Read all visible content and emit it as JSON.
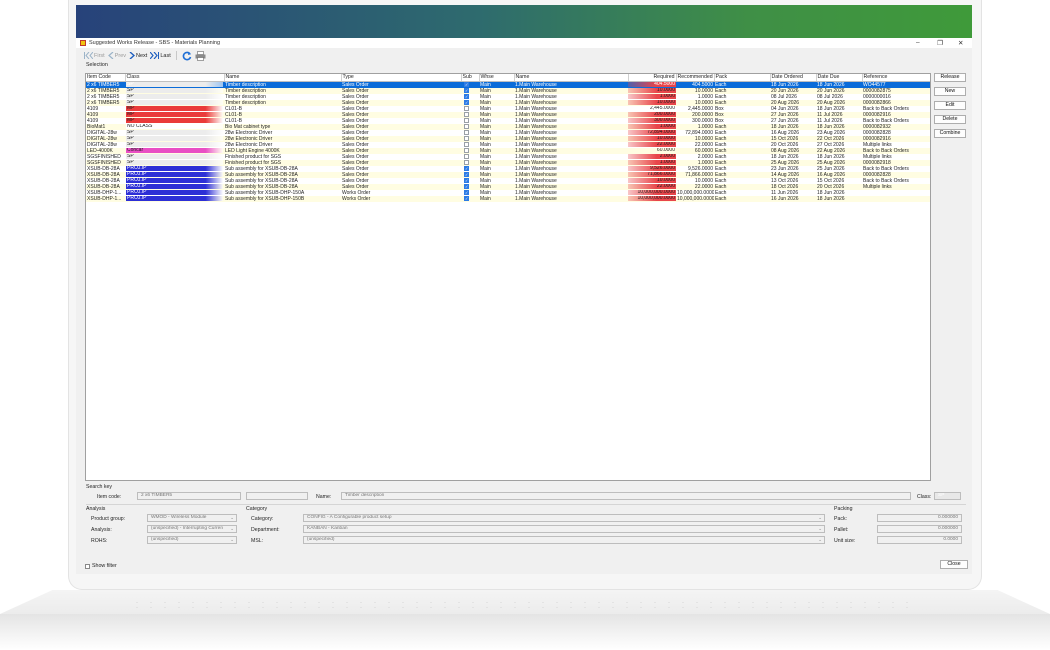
{
  "window": {
    "title": "Suggested Works Release - SBS - Materials Planning",
    "minimize": "–",
    "maximize": "❐",
    "close": "✕"
  },
  "toolbar": {
    "first": "First",
    "prev": "Prev",
    "next": "Next",
    "last": "Last"
  },
  "selection_label": "Selection",
  "columns": [
    "Item Code",
    "Class",
    "Name",
    "Type",
    "Sub",
    "Whse",
    "Name",
    "Required",
    "Recommended",
    "Pack",
    "Date Ordered",
    "Date Due",
    "Reference"
  ],
  "class_colors": {
    "SP": "#ececec",
    "MP": "#ea3a3a",
    "NO CLASS": "#ffffff",
    "Concar": "#e94fc4",
    "PROJ.IP": "#2d2fd6"
  },
  "rows": [
    {
      "code": "2 x6 TIMBER5",
      "cls": "SP",
      "name": "Timber description",
      "type": "Sales Order",
      "sub": true,
      "whse": "Main",
      "wname": "1.Main Warehouse",
      "req": "404.5000",
      "req_red": true,
      "rec": "404.5000",
      "pack": "Each",
      "ordered": "18 Jun 2026",
      "due": "18 Jun 2026",
      "ref": "WO44577",
      "selected": true
    },
    {
      "code": "2 x6 TIMBER5",
      "cls": "SP",
      "name": "Timber description",
      "type": "Sales Order",
      "sub": true,
      "whse": "Main",
      "wname": "1.Main Warehouse",
      "req": "10.0000",
      "req_red": true,
      "rec": "10.0000",
      "pack": "Each",
      "ordered": "20 Jun 2026",
      "due": "20 Jun 2026",
      "ref": "0000082875"
    },
    {
      "code": "2 x6 TIMBER5",
      "cls": "SP",
      "name": "Timber description",
      "type": "Sales Order",
      "sub": true,
      "whse": "Main",
      "wname": "1.Main Warehouse",
      "req": "1.0000",
      "req_red": true,
      "rec": "1.0000",
      "pack": "Each",
      "ordered": "08 Jul 2026",
      "due": "08 Jul 2026",
      "ref": "0000000016"
    },
    {
      "code": "2 x6 TIMBER5",
      "cls": "SP",
      "name": "Timber description",
      "type": "Sales Order",
      "sub": true,
      "whse": "Main",
      "wname": "1.Main Warehouse",
      "req": "10.0000",
      "req_red": true,
      "rec": "10.0000",
      "pack": "Each",
      "ordered": "20 Aug 2026",
      "due": "20 Aug 2026",
      "ref": "0000082866"
    },
    {
      "code": "4109",
      "cls": "MP",
      "name": "CL01-B",
      "type": "Sales Order",
      "sub": false,
      "whse": "Main",
      "wname": "1.Main Warehouse",
      "req": "2,445.0000",
      "req_red": false,
      "rec": "2,445.0000",
      "pack": "Box",
      "ordered": "04 Jun 2026",
      "due": "18 Jun 2026",
      "ref": "Back to Back Orders"
    },
    {
      "code": "4109",
      "cls": "MP",
      "name": "CL01-B",
      "type": "Sales Order",
      "sub": false,
      "whse": "Main",
      "wname": "1.Main Warehouse",
      "req": "200.0000",
      "req_red": true,
      "rec": "200.0000",
      "pack": "Box",
      "ordered": "27 Jun 2026",
      "due": "11 Jul 2026",
      "ref": "0000082916"
    },
    {
      "code": "4109",
      "cls": "MP",
      "name": "CL01-B",
      "type": "Sales Order",
      "sub": false,
      "whse": "Main",
      "wname": "1.Main Warehouse",
      "req": "300.0000",
      "req_red": true,
      "rec": "300.0000",
      "pack": "Box",
      "ordered": "27 Jun 2026",
      "due": "11 Jul 2026",
      "ref": "Back to Back Orders"
    },
    {
      "code": "BioMat1",
      "cls": "NO CLASS",
      "name": "Bio Mat cabinet type",
      "type": "Sales Order",
      "sub": false,
      "whse": "Main",
      "wname": "1.Main Warehouse",
      "req": "1.0000",
      "req_red": true,
      "rec": "1.0000",
      "pack": "Each",
      "ordered": "18 Jun 2026",
      "due": "18 Jun 2026",
      "ref": "0000082932"
    },
    {
      "code": "DIGITAL-28w",
      "cls": "SP",
      "name": "28w Electronic Driver",
      "type": "Sales Order",
      "sub": false,
      "whse": "Main",
      "wname": "1.Main Warehouse",
      "req": "72,894.0000",
      "req_red": true,
      "rec": "72,894.0000",
      "pack": "Each",
      "ordered": "16 Aug 2026",
      "due": "23 Aug 2026",
      "ref": "0000082828"
    },
    {
      "code": "DIGITAL-28w",
      "cls": "SP",
      "name": "28w Electronic Driver",
      "type": "Sales Order",
      "sub": false,
      "whse": "Main",
      "wname": "1.Main Warehouse",
      "req": "10.0000",
      "req_red": true,
      "rec": "10.0000",
      "pack": "Each",
      "ordered": "15 Oct 2026",
      "due": "22 Oct 2026",
      "ref": "0000082916"
    },
    {
      "code": "DIGITAL-28w",
      "cls": "SP",
      "name": "28w Electronic Driver",
      "type": "Sales Order",
      "sub": false,
      "whse": "Main",
      "wname": "1.Main Warehouse",
      "req": "22.0000",
      "req_red": true,
      "rec": "22.0000",
      "pack": "Each",
      "ordered": "20 Oct 2026",
      "due": "27 Oct 2026",
      "ref": "Multiple links"
    },
    {
      "code": "LED-4000K",
      "cls": "Concar",
      "name": "LED Light Engine 4000K",
      "type": "Sales Order",
      "sub": false,
      "whse": "Main",
      "wname": "1.Main Warehouse",
      "req": "60.0000",
      "req_red": false,
      "rec": "60.0000",
      "pack": "Each",
      "ordered": "08 Aug 2026",
      "due": "22 Aug 2026",
      "ref": "Back to Back Orders"
    },
    {
      "code": "SGSFINISHED",
      "cls": "SP",
      "name": "Finished product for SGS",
      "type": "Sales Order",
      "sub": false,
      "whse": "Main",
      "wname": "1.Main Warehouse",
      "req": "2.0000",
      "req_red": true,
      "rec": "2.0000",
      "pack": "Each",
      "ordered": "18 Jun 2026",
      "due": "18 Jun 2026",
      "ref": "Multiple links"
    },
    {
      "code": "SGSFINISHED",
      "cls": "SP",
      "name": "Finished product for SGS",
      "type": "Sales Order",
      "sub": false,
      "whse": "Main",
      "wname": "1.Main Warehouse",
      "req": "1.0000",
      "req_red": true,
      "rec": "1.0000",
      "pack": "Each",
      "ordered": "25 Aug 2026",
      "due": "25 Aug 2026",
      "ref": "0000082918"
    },
    {
      "code": "XSUB-DB-28A",
      "cls": "PROJ.IP",
      "name": "Sub assembly for XSUB-DB-28A",
      "type": "Sales Order",
      "sub": true,
      "whse": "Main",
      "wname": "1.Main Warehouse",
      "req": "9,526.0000",
      "req_red": true,
      "rec": "9,526.0000",
      "pack": "Each",
      "ordered": "23 Jun 2026",
      "due": "25 Jun 2026",
      "ref": "Back to Back Orders"
    },
    {
      "code": "XSUB-DB-28A",
      "cls": "PROJ.IP",
      "name": "Sub assembly for XSUB-DB-28A",
      "type": "Sales Order",
      "sub": true,
      "whse": "Main",
      "wname": "1.Main Warehouse",
      "req": "71,866.0000",
      "req_red": true,
      "rec": "71,866.0000",
      "pack": "Each",
      "ordered": "14 Aug 2026",
      "due": "16 Aug 2026",
      "ref": "0000082828"
    },
    {
      "code": "XSUB-DB-28A",
      "cls": "PROJ.IP",
      "name": "Sub assembly for XSUB-DB-28A",
      "type": "Sales Order",
      "sub": true,
      "whse": "Main",
      "wname": "1.Main Warehouse",
      "req": "10.0000",
      "req_red": true,
      "rec": "10.0000",
      "pack": "Each",
      "ordered": "13 Oct 2026",
      "due": "15 Oct 2026",
      "ref": "Back to Back Orders"
    },
    {
      "code": "XSUB-DB-28A",
      "cls": "PROJ.IP",
      "name": "Sub assembly for XSUB-DB-28A",
      "type": "Sales Order",
      "sub": true,
      "whse": "Main",
      "wname": "1.Main Warehouse",
      "req": "22.0000",
      "req_red": true,
      "rec": "22.0000",
      "pack": "Each",
      "ordered": "18 Oct 2026",
      "due": "20 Oct 2026",
      "ref": "Multiple links"
    },
    {
      "code": "XSUB-DHP-1...",
      "cls": "PROJ.IP",
      "name": "Sub assembly for XSUB-DHP-150A",
      "type": "Works Order",
      "sub": true,
      "whse": "Main",
      "wname": "1.Main Warehouse",
      "req": "10,000,000.0000",
      "req_red": true,
      "rec": "10,000,000.0000",
      "pack": "Each",
      "ordered": "11 Jun 2026",
      "due": "18 Jun 2026",
      "ref": ""
    },
    {
      "code": "XSUB-DHP-1...",
      "cls": "PROJ.IP",
      "name": "Sub assembly for XSUB-DHP-150B",
      "type": "Works Order",
      "sub": true,
      "whse": "Main",
      "wname": "1.Main Warehouse",
      "req": "10,000,000.0000",
      "req_red": true,
      "rec": "10,000,000.0000",
      "pack": "Each",
      "ordered": "16 Jun 2026",
      "due": "18 Jun 2026",
      "ref": ""
    }
  ],
  "side_buttons": [
    "Release",
    "New",
    "Edit",
    "Delete",
    "Combine"
  ],
  "search_key": {
    "group": "Search key",
    "item_code_label": "Item code:",
    "item_code": "2 x6 TIMBER5",
    "name_label": "Name:",
    "name": "Timber description",
    "class_label": "Class:",
    "class_value": "SP"
  },
  "analysis": {
    "group": "Analysis",
    "product_group_label": "Product group:",
    "product_group": "WMOD - Wireless Module",
    "analysis_label": "Analysis:",
    "analysis": "(unspecified) - Interrupting Curren",
    "rohs_label": "ROHS:",
    "rohs": "(unspecified)"
  },
  "category": {
    "group": "Category",
    "category_label": "Category:",
    "category": "CONFIG - A Configurable product setup",
    "department_label": "Department:",
    "department": "KANBAN - Kanban",
    "msl_label": "MSL:",
    "msl": "(unspecified)"
  },
  "packing": {
    "group": "Packing",
    "pack_label": "Pack:",
    "pack": "0.000000",
    "pallet_label": "Pallet:",
    "pallet": "0.000000",
    "unit_size_label": "Unit size:",
    "unit_size": "0.0000"
  },
  "footer": {
    "show_filter": "Show filter",
    "close": "Close"
  },
  "colors": {
    "selected_row": "#0b6cd9",
    "even_row": "#fffde2",
    "required_red": "#e8454a"
  }
}
